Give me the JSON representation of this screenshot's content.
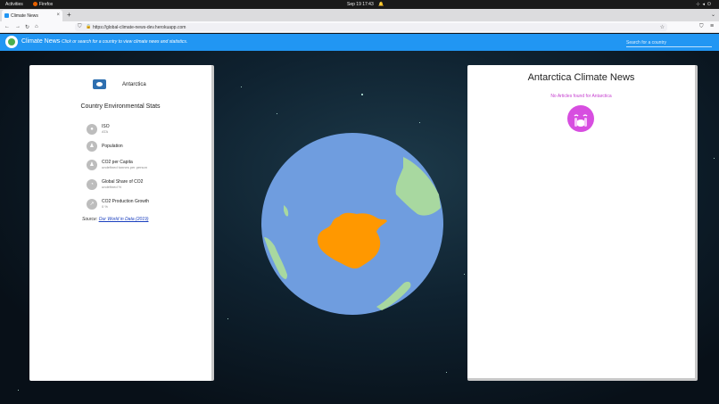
{
  "system_bar": {
    "activities": "Activities",
    "app_name": "Firefox",
    "clock": "Sep 19  17:43"
  },
  "browser": {
    "tab_title": "Climate News",
    "url": "https://global-climate-news-dev.herokuapp.com"
  },
  "app": {
    "brand": "Climate News",
    "tagline": "- Click or search for a country to view climate news and statistics.",
    "search_placeholder": "Search for a country",
    "accent_color": "#2196f3"
  },
  "left_panel": {
    "country": "Antarctica",
    "stats_title": "Country Environmental Stats",
    "stats": [
      {
        "icon": "info-icon",
        "label": "ISO",
        "value": "ATA"
      },
      {
        "icon": "person-icon",
        "label": "Population",
        "value": ""
      },
      {
        "icon": "people-icon",
        "label": "CO2 per Capita",
        "value": "undefined tonnes per person"
      },
      {
        "icon": "pie-icon",
        "label": "Global Share of CO2",
        "value": "undefined %"
      },
      {
        "icon": "trend-icon",
        "label": "CO2 Production Growth",
        "value": "0 %"
      }
    ],
    "source_prefix": "Source: ",
    "source_link": "Our World in Data (2019)"
  },
  "right_panel": {
    "title": "Antarctica Climate News",
    "empty_message": "No Articles found for Antarctica",
    "empty_icon": "crying-face-icon",
    "empty_color": "#c53ecf"
  },
  "globe": {
    "ocean_color": "#6f9ddf",
    "land_color": "#a8d8a0",
    "selected_color": "#ff9800"
  }
}
